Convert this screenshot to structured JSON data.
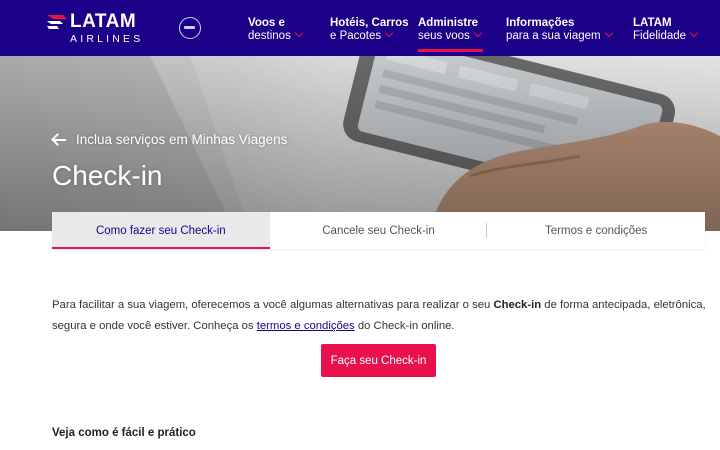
{
  "brand": {
    "name": "LATAM",
    "sub": "AIRLINES",
    "primary_color": "#1b0088",
    "accent_color": "#e8114b"
  },
  "nav": {
    "items": [
      {
        "line1": "Voos e",
        "line2": "destinos",
        "active": false
      },
      {
        "line1": "Hotéis, Carros",
        "line2": "e Pacotes",
        "active": false
      },
      {
        "line1": "Administre",
        "line2": "seus voos",
        "active": true
      },
      {
        "line1": "Informações",
        "line2": "para a sua viagem",
        "active": false
      },
      {
        "line1": "LATAM",
        "line2": "Fidelidade",
        "active": false
      }
    ]
  },
  "hero": {
    "breadcrumb": "Inclua serviços em Minhas Viagens",
    "title": "Check-in"
  },
  "tabs": [
    {
      "label": "Como fazer seu Check-in",
      "active": true
    },
    {
      "label": "Cancele seu Check-in",
      "active": false
    },
    {
      "label": "Termos e condições",
      "active": false
    }
  ],
  "content": {
    "intro_part1": "Para facilitar a sua viagem, oferecemos a você algumas alternativas para realizar o seu ",
    "intro_bold": "Check-in",
    "intro_part2": " de forma antecipada, eletrônica, segura e onde você estiver. Conheça os ",
    "intro_link": "termos e condições",
    "intro_part3": " do Check-in online.",
    "cta_label": "Faça seu Check-in",
    "subheading": "Veja como é fácil e prático"
  }
}
